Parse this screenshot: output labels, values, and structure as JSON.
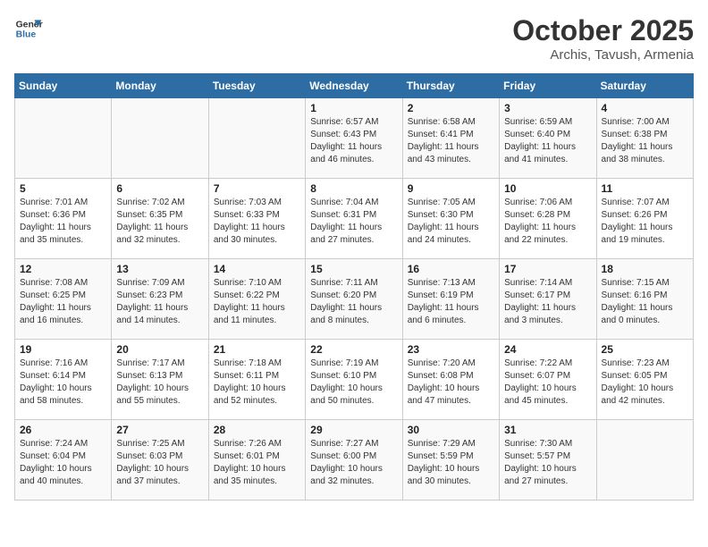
{
  "header": {
    "logo_line1": "General",
    "logo_line2": "Blue",
    "title": "October 2025",
    "subtitle": "Archis, Tavush, Armenia"
  },
  "days_of_week": [
    "Sunday",
    "Monday",
    "Tuesday",
    "Wednesday",
    "Thursday",
    "Friday",
    "Saturday"
  ],
  "weeks": [
    [
      {
        "day": "",
        "info": ""
      },
      {
        "day": "",
        "info": ""
      },
      {
        "day": "",
        "info": ""
      },
      {
        "day": "1",
        "info": "Sunrise: 6:57 AM\nSunset: 6:43 PM\nDaylight: 11 hours\nand 46 minutes."
      },
      {
        "day": "2",
        "info": "Sunrise: 6:58 AM\nSunset: 6:41 PM\nDaylight: 11 hours\nand 43 minutes."
      },
      {
        "day": "3",
        "info": "Sunrise: 6:59 AM\nSunset: 6:40 PM\nDaylight: 11 hours\nand 41 minutes."
      },
      {
        "day": "4",
        "info": "Sunrise: 7:00 AM\nSunset: 6:38 PM\nDaylight: 11 hours\nand 38 minutes."
      }
    ],
    [
      {
        "day": "5",
        "info": "Sunrise: 7:01 AM\nSunset: 6:36 PM\nDaylight: 11 hours\nand 35 minutes."
      },
      {
        "day": "6",
        "info": "Sunrise: 7:02 AM\nSunset: 6:35 PM\nDaylight: 11 hours\nand 32 minutes."
      },
      {
        "day": "7",
        "info": "Sunrise: 7:03 AM\nSunset: 6:33 PM\nDaylight: 11 hours\nand 30 minutes."
      },
      {
        "day": "8",
        "info": "Sunrise: 7:04 AM\nSunset: 6:31 PM\nDaylight: 11 hours\nand 27 minutes."
      },
      {
        "day": "9",
        "info": "Sunrise: 7:05 AM\nSunset: 6:30 PM\nDaylight: 11 hours\nand 24 minutes."
      },
      {
        "day": "10",
        "info": "Sunrise: 7:06 AM\nSunset: 6:28 PM\nDaylight: 11 hours\nand 22 minutes."
      },
      {
        "day": "11",
        "info": "Sunrise: 7:07 AM\nSunset: 6:26 PM\nDaylight: 11 hours\nand 19 minutes."
      }
    ],
    [
      {
        "day": "12",
        "info": "Sunrise: 7:08 AM\nSunset: 6:25 PM\nDaylight: 11 hours\nand 16 minutes."
      },
      {
        "day": "13",
        "info": "Sunrise: 7:09 AM\nSunset: 6:23 PM\nDaylight: 11 hours\nand 14 minutes."
      },
      {
        "day": "14",
        "info": "Sunrise: 7:10 AM\nSunset: 6:22 PM\nDaylight: 11 hours\nand 11 minutes."
      },
      {
        "day": "15",
        "info": "Sunrise: 7:11 AM\nSunset: 6:20 PM\nDaylight: 11 hours\nand 8 minutes."
      },
      {
        "day": "16",
        "info": "Sunrise: 7:13 AM\nSunset: 6:19 PM\nDaylight: 11 hours\nand 6 minutes."
      },
      {
        "day": "17",
        "info": "Sunrise: 7:14 AM\nSunset: 6:17 PM\nDaylight: 11 hours\nand 3 minutes."
      },
      {
        "day": "18",
        "info": "Sunrise: 7:15 AM\nSunset: 6:16 PM\nDaylight: 11 hours\nand 0 minutes."
      }
    ],
    [
      {
        "day": "19",
        "info": "Sunrise: 7:16 AM\nSunset: 6:14 PM\nDaylight: 10 hours\nand 58 minutes."
      },
      {
        "day": "20",
        "info": "Sunrise: 7:17 AM\nSunset: 6:13 PM\nDaylight: 10 hours\nand 55 minutes."
      },
      {
        "day": "21",
        "info": "Sunrise: 7:18 AM\nSunset: 6:11 PM\nDaylight: 10 hours\nand 52 minutes."
      },
      {
        "day": "22",
        "info": "Sunrise: 7:19 AM\nSunset: 6:10 PM\nDaylight: 10 hours\nand 50 minutes."
      },
      {
        "day": "23",
        "info": "Sunrise: 7:20 AM\nSunset: 6:08 PM\nDaylight: 10 hours\nand 47 minutes."
      },
      {
        "day": "24",
        "info": "Sunrise: 7:22 AM\nSunset: 6:07 PM\nDaylight: 10 hours\nand 45 minutes."
      },
      {
        "day": "25",
        "info": "Sunrise: 7:23 AM\nSunset: 6:05 PM\nDaylight: 10 hours\nand 42 minutes."
      }
    ],
    [
      {
        "day": "26",
        "info": "Sunrise: 7:24 AM\nSunset: 6:04 PM\nDaylight: 10 hours\nand 40 minutes."
      },
      {
        "day": "27",
        "info": "Sunrise: 7:25 AM\nSunset: 6:03 PM\nDaylight: 10 hours\nand 37 minutes."
      },
      {
        "day": "28",
        "info": "Sunrise: 7:26 AM\nSunset: 6:01 PM\nDaylight: 10 hours\nand 35 minutes."
      },
      {
        "day": "29",
        "info": "Sunrise: 7:27 AM\nSunset: 6:00 PM\nDaylight: 10 hours\nand 32 minutes."
      },
      {
        "day": "30",
        "info": "Sunrise: 7:29 AM\nSunset: 5:59 PM\nDaylight: 10 hours\nand 30 minutes."
      },
      {
        "day": "31",
        "info": "Sunrise: 7:30 AM\nSunset: 5:57 PM\nDaylight: 10 hours\nand 27 minutes."
      },
      {
        "day": "",
        "info": ""
      }
    ]
  ]
}
